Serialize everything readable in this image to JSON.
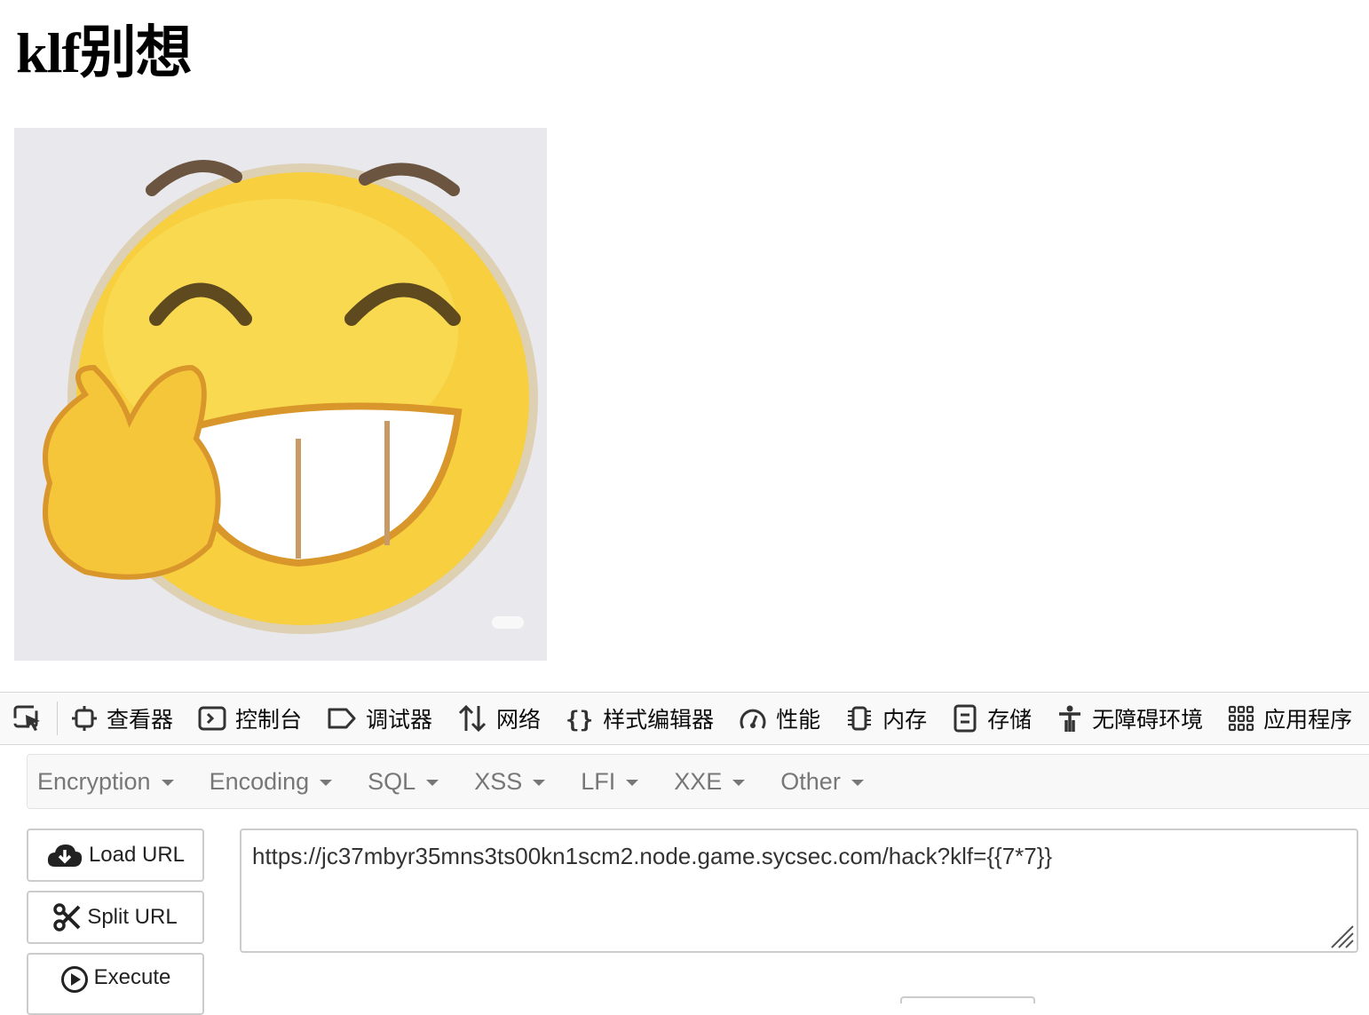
{
  "page": {
    "title": "klf别想"
  },
  "image": {
    "alt": "grinning emoji with peace sign"
  },
  "devtools": {
    "tabs": [
      {
        "label": "查看器",
        "icon": "inspector-icon"
      },
      {
        "label": "控制台",
        "icon": "console-icon"
      },
      {
        "label": "调试器",
        "icon": "debugger-icon"
      },
      {
        "label": "网络",
        "icon": "network-icon"
      },
      {
        "label": "样式编辑器",
        "icon": "style-editor-icon"
      },
      {
        "label": "性能",
        "icon": "performance-icon"
      },
      {
        "label": "内存",
        "icon": "memory-icon"
      },
      {
        "label": "存储",
        "icon": "storage-icon"
      },
      {
        "label": "无障碍环境",
        "icon": "accessibility-icon"
      },
      {
        "label": "应用程序",
        "icon": "application-icon"
      }
    ]
  },
  "hackbar": {
    "menu": [
      "Encryption",
      "Encoding",
      "SQL",
      "XSS",
      "LFI",
      "XXE",
      "Other"
    ],
    "buttons": {
      "load": "Load URL",
      "split": "Split URL",
      "execute": "Execute"
    },
    "url": "https://jc37mbyr35mns3ts00kn1scm2.node.game.sycsec.com/hack?klf={{7*7}}"
  }
}
